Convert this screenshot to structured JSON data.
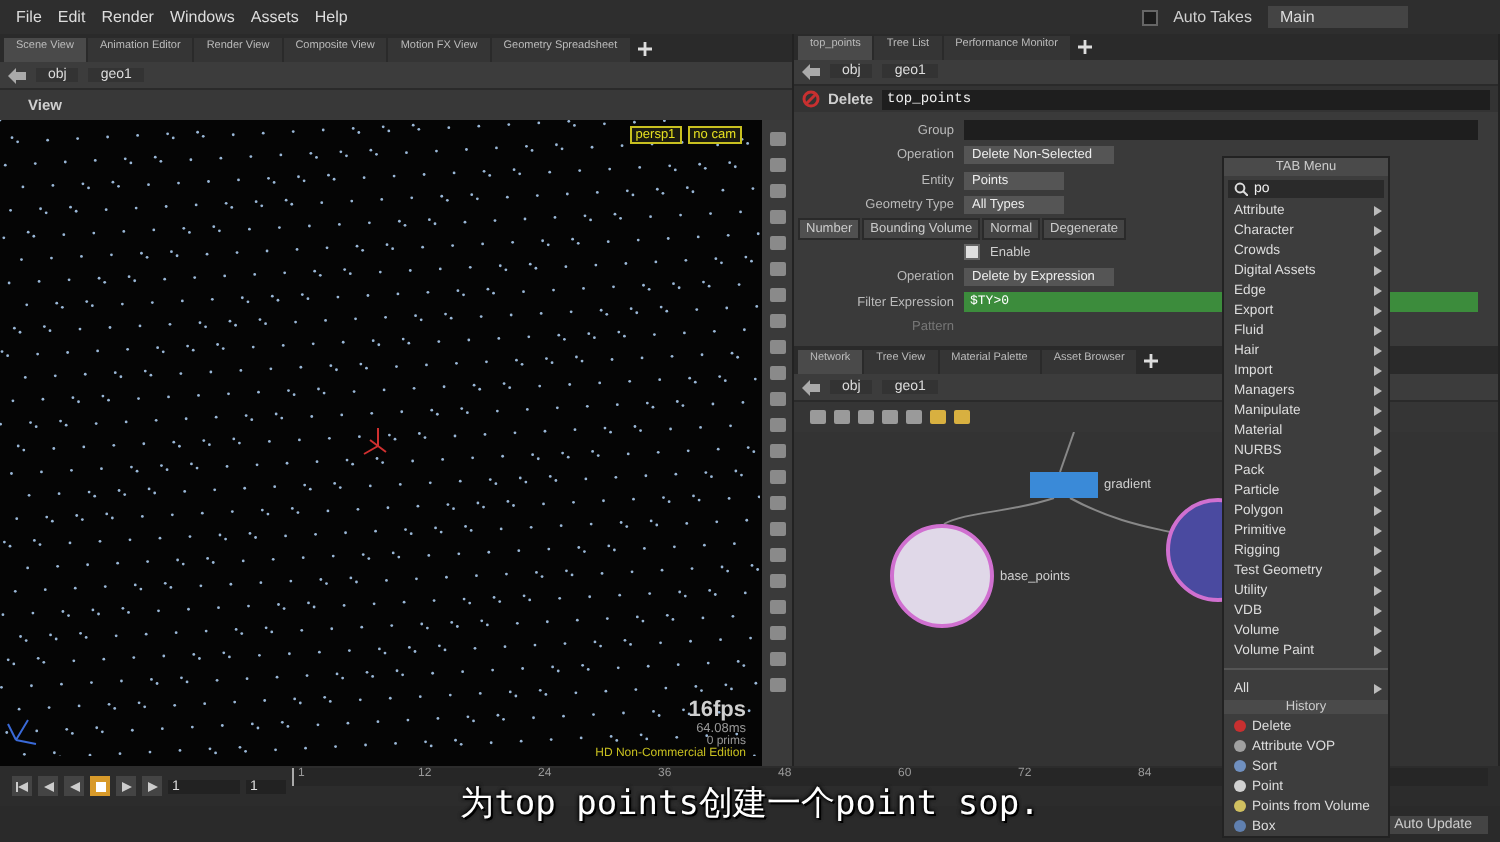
{
  "menu_bar": {
    "items": [
      "File",
      "Edit",
      "Render",
      "Windows",
      "Assets",
      "Help"
    ],
    "auto_takes": {
      "label": "Auto Takes",
      "checked": false
    },
    "take": "Main"
  },
  "scene_pane": {
    "tabs": [
      {
        "label": "Scene View",
        "selected": true
      },
      {
        "label": "Animation Editor",
        "selected": false
      },
      {
        "label": "Render View",
        "selected": false
      },
      {
        "label": "Composite View",
        "selected": false
      },
      {
        "label": "Motion FX View",
        "selected": false
      },
      {
        "label": "Geometry Spreadsheet",
        "selected": false
      }
    ],
    "path": [
      "obj",
      "geo1"
    ],
    "view_title": "View",
    "camera_menus": [
      "persp1",
      "no cam"
    ],
    "stats": {
      "fps": "16fps",
      "time": "64.08ms",
      "prims": "0  prims",
      "edition": "HD Non-Commercial Edition"
    }
  },
  "param_pane": {
    "tabs": [
      {
        "label": "top_points",
        "selected": true
      },
      {
        "label": "Tree List",
        "selected": false
      },
      {
        "label": "Performance Monitor",
        "selected": false
      }
    ],
    "path": [
      "obj",
      "geo1"
    ],
    "node_type": "Delete",
    "node_name": "top_points",
    "rows": [
      {
        "kind": "field",
        "label": "Group"
      },
      {
        "kind": "dropdown",
        "label": "Operation",
        "value": "Delete Non-Selected"
      },
      {
        "kind": "dropdown",
        "label": "Entity",
        "value": "Points"
      },
      {
        "kind": "dropdown",
        "label": "Geometry Type",
        "value": "All Types"
      }
    ],
    "tabs_2": [
      {
        "label": "Number",
        "selected": true
      },
      {
        "label": "Bounding Volume",
        "selected": false
      },
      {
        "label": "Normal",
        "selected": false
      },
      {
        "label": "Degenerate",
        "selected": false
      }
    ],
    "rows_2": [
      {
        "kind": "checkbox",
        "label": "Enable",
        "checked": true
      },
      {
        "kind": "dropdown",
        "label": "Operation",
        "value": "Delete by Expression"
      },
      {
        "kind": "expression",
        "label": "Filter Expression",
        "value": "$TY>0"
      },
      {
        "kind": "label",
        "label": "Pattern",
        "disabled": true
      }
    ]
  },
  "network_pane": {
    "tabs": [
      {
        "label": "Network",
        "selected": true
      },
      {
        "label": "Tree View",
        "selected": false
      },
      {
        "label": "Material Palette",
        "selected": false
      },
      {
        "label": "Asset Browser",
        "selected": false
      }
    ],
    "path": [
      "obj",
      "geo1"
    ],
    "nodes": [
      {
        "kind": "box",
        "name": "gradient"
      },
      {
        "kind": "circled",
        "name": "base_points"
      },
      {
        "kind": "circled"
      }
    ]
  },
  "tab_menu": {
    "title": "TAB Menu",
    "search": "po",
    "categories": [
      "Attribute",
      "Character",
      "Crowds",
      "Digital Assets",
      "Edge",
      "Export",
      "Fluid",
      "Hair",
      "Import",
      "Managers",
      "Manipulate",
      "Material",
      "NURBS",
      "Pack",
      "Particle",
      "Polygon",
      "Primitive",
      "Rigging",
      "Test Geometry",
      "Utility",
      "VDB",
      "Volume",
      "Volume Paint"
    ],
    "all": "All",
    "history_title": "History",
    "history": [
      "Delete",
      "Attribute VOP",
      "Sort",
      "Point",
      "Points from Volume",
      "Box"
    ]
  },
  "playbar": {
    "buttons": [
      {
        "kind": "first",
        "selected": false
      },
      {
        "kind": "prev_key",
        "selected": false
      },
      {
        "kind": "reverse",
        "selected": false
      },
      {
        "kind": "stop",
        "selected": true
      },
      {
        "kind": "play",
        "selected": false
      },
      {
        "kind": "last",
        "selected": false
      }
    ],
    "frame": "1",
    "start": "1",
    "ruler_labels": [
      "1",
      "12",
      "24",
      "36",
      "48",
      "60",
      "72",
      "84"
    ]
  },
  "status_bar": {
    "update_mode": "Auto Update"
  },
  "subtitle": "为top points创建一个point sop."
}
